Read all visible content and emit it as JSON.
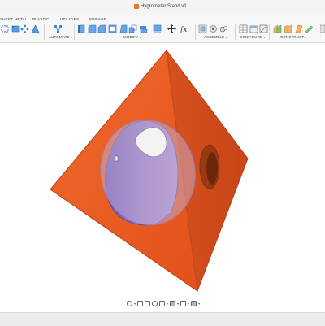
{
  "window": {
    "title": "Hygrometer Stand v1"
  },
  "ribbon": {
    "tabs": [
      "SHEET METAL",
      "PLASTIC",
      "UTILITIES",
      "MANAGE"
    ],
    "groups": {
      "automate": "AUTOMATE",
      "modify": "MODIFY",
      "assemble": "ASSEMBLE",
      "configure": "CONFIGURE",
      "construct": "CONSTRUCT"
    },
    "caret": "▾"
  },
  "viewport": {
    "model_color": "#e85a25",
    "hole_color": "#7a6fd6",
    "selection_highlight": "#c4a3b8"
  },
  "navbar": {
    "icons": [
      "orbit-icon",
      "pan-icon",
      "look-at-icon",
      "zoom-icon",
      "fit-icon",
      "display-settings-icon",
      "grid-settings-icon",
      "viewports-icon"
    ]
  }
}
